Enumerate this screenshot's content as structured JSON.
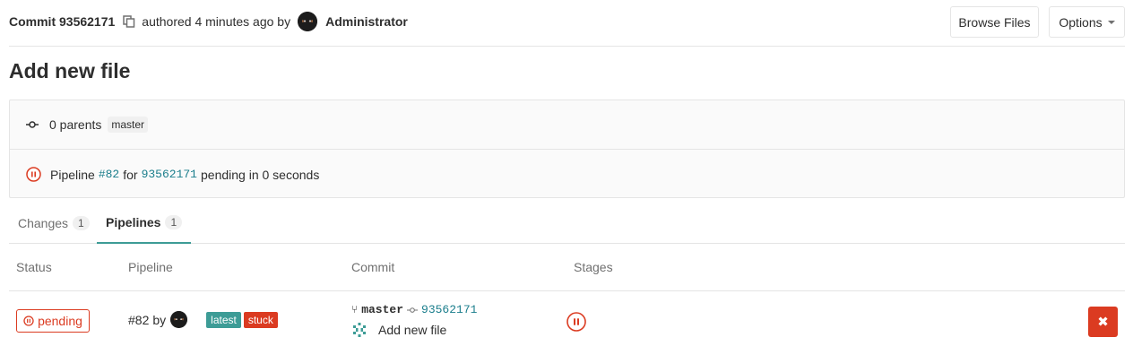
{
  "header": {
    "commit_label": "Commit 93562171",
    "authored_text": "authored 4 minutes ago by",
    "author_name": "Administrator",
    "browse_files_label": "Browse Files",
    "options_label": "Options"
  },
  "title": "Add new file",
  "info": {
    "parents_text": "0 parents",
    "branch_badge": "master",
    "pipeline_word": "Pipeline",
    "pipeline_link": "#82",
    "for_word": "for",
    "commit_link": "93562171",
    "pending_text": "pending in 0 seconds"
  },
  "tabs": [
    {
      "label": "Changes",
      "count": "1"
    },
    {
      "label": "Pipelines",
      "count": "1"
    }
  ],
  "table": {
    "headers": [
      "Status",
      "Pipeline",
      "Commit",
      "Stages"
    ],
    "rows": [
      {
        "status": "pending",
        "pipeline_id": "#82",
        "by": "by",
        "labels": [
          "latest",
          "stuck"
        ],
        "branch": "master",
        "commit_hash": "93562171",
        "commit_title": "Add new file",
        "cancel_symbol": "✖"
      }
    ]
  },
  "colors": {
    "danger": "#db3b21",
    "teal": "#3d9c96",
    "link": "#1b7e8c"
  }
}
